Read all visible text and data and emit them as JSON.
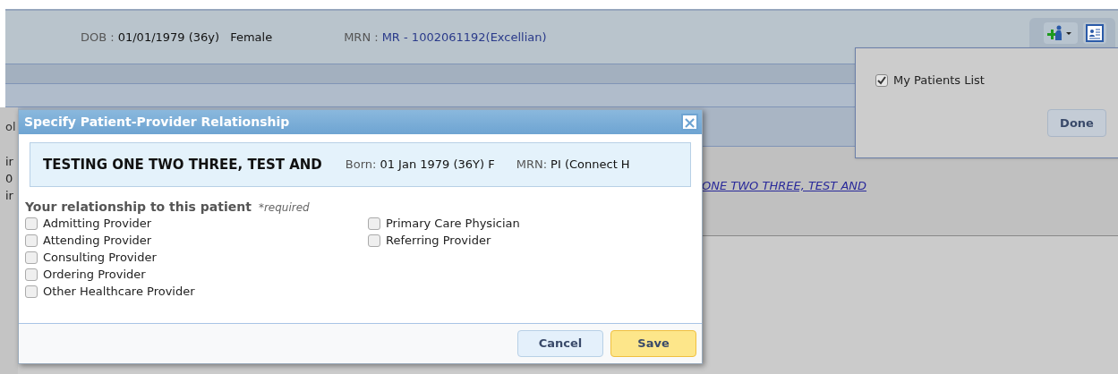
{
  "patient_header": {
    "dob_label": "DOB :",
    "dob_value": "01/01/1979 (36y)",
    "sex": "Female",
    "mrn_label": "MRN :",
    "mrn_value": "MR - 1002061192(Excellian)"
  },
  "background": {
    "left_fragments": [
      "ol",
      "ir",
      "0",
      "ir"
    ],
    "patient_link": "ONE TWO THREE, TEST AND"
  },
  "popover": {
    "items": [
      {
        "label": "My Patients List",
        "checked": true
      }
    ],
    "done_button": "Done"
  },
  "dialog": {
    "title": "Specify Patient-Provider Relationship",
    "close": "×",
    "patient": {
      "name": "TESTING ONE TWO THREE, TEST AND",
      "born_label": "Born:",
      "born_value": "01 Jan 1979 (36Y) F",
      "mrn_label": "MRN:",
      "mrn_value": "PI (Connect H"
    },
    "question": "Your relationship to this patient",
    "required": "*required",
    "columns": [
      [
        {
          "label": "Admitting Provider",
          "checked": false
        },
        {
          "label": "Attending Provider",
          "checked": false
        },
        {
          "label": "Consulting Provider",
          "checked": false
        },
        {
          "label": "Ordering Provider",
          "checked": false
        },
        {
          "label": "Other Healthcare Provider",
          "checked": false
        }
      ],
      [
        {
          "label": "Primary Care Physician",
          "checked": false
        },
        {
          "label": "Referring Provider",
          "checked": false
        }
      ]
    ],
    "buttons": [
      {
        "label": "Cancel",
        "kind": "secondary"
      },
      {
        "label": "Save",
        "kind": "primary"
      }
    ]
  }
}
